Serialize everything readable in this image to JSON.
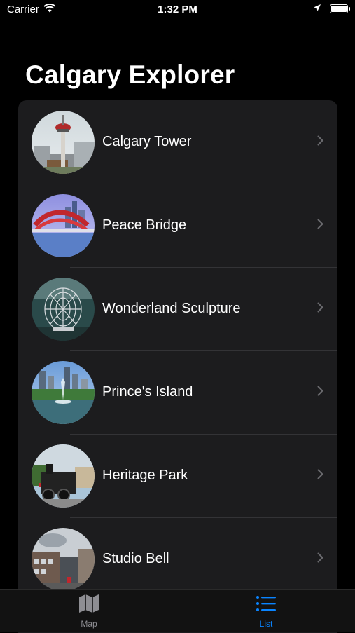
{
  "status_bar": {
    "carrier": "Carrier",
    "time": "1:32 PM"
  },
  "header": {
    "title": "Calgary Explorer"
  },
  "places": [
    {
      "name": "Calgary Tower",
      "thumb": "calgary-tower-photo"
    },
    {
      "name": "Peace Bridge",
      "thumb": "peace-bridge-photo"
    },
    {
      "name": "Wonderland Sculpture",
      "thumb": "wonderland-sculpture-photo"
    },
    {
      "name": "Prince's Island",
      "thumb": "princes-island-photo"
    },
    {
      "name": "Heritage Park",
      "thumb": "heritage-park-photo"
    },
    {
      "name": "Studio Bell",
      "thumb": "studio-bell-photo"
    }
  ],
  "tab_bar": {
    "tabs": [
      {
        "label": "Map",
        "icon": "map-icon",
        "selected": false
      },
      {
        "label": "List",
        "icon": "list-icon",
        "selected": true
      }
    ]
  },
  "colors": {
    "accent": "#0a84ff",
    "inactive": "#8e8e93",
    "cell": "#1c1c1e",
    "background": "#000000"
  }
}
